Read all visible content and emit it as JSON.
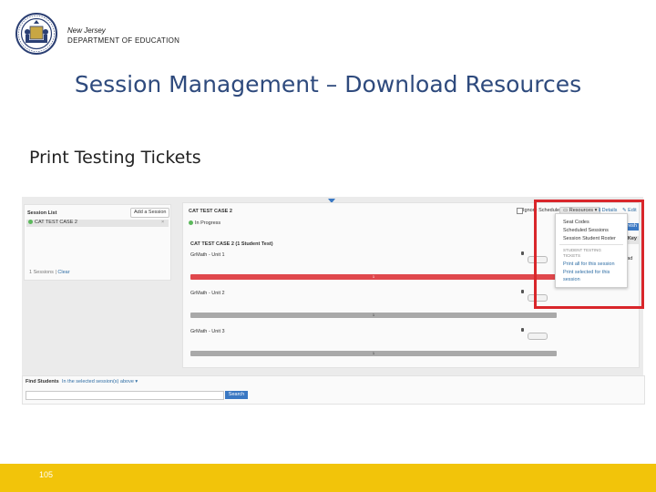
{
  "header": {
    "org_state": "New Jersey",
    "org_dept": "DEPARTMENT OF EDUCATION",
    "seal_icon": "nj-state-seal"
  },
  "slide": {
    "title": "Session Management – Download Resources",
    "subtitle": "Print Testing Tickets",
    "page_number": "105"
  },
  "app": {
    "session_list": {
      "title": "Session List",
      "add_button": "Add a Session",
      "item": "CAT TEST CASE 2",
      "close": "×",
      "footer_count": "1 Sessions",
      "footer_sep": "|",
      "footer_clear": "Clear"
    },
    "session": {
      "title": "CAT TEST CASE 2",
      "ignore_schedule": "Ignore Schedule",
      "resources_button": "Resources",
      "details": "Details",
      "edit": "Edit",
      "status": "In Progress",
      "refresh": "Refresh",
      "key": "Key",
      "upload": "pload",
      "student_test": "CAT TEST CASE 2 (1 Student Test)",
      "units": [
        {
          "name": "GrMath - Unit 1",
          "bar_label": "1"
        },
        {
          "name": "GrMath - Unit 2",
          "bar_label": "1"
        },
        {
          "name": "GrMath - Unit 3",
          "bar_label": "1"
        }
      ]
    },
    "resources_menu": {
      "items": [
        "Seat Codes",
        "Scheduled Sessions",
        "Session Student Roster"
      ],
      "section_label_1": "STUDENT TESTING",
      "section_label_2": "TICKETS",
      "print_all": "Print all for this session",
      "print_selected_1": "Print selected for this",
      "print_selected_2": "session"
    },
    "find_students": {
      "label": "Find Students",
      "scope": "In the selected session(s) above",
      "caret": "▾",
      "search_button": "Search",
      "search_value": ""
    }
  },
  "colors": {
    "title_blue": "#2e4a7d",
    "footer_yellow": "#f2c40a",
    "highlight_red": "#d9262b",
    "unit1_bar": "#e0474c",
    "neutral_bar": "#a9a9a9",
    "primary_blue": "#3a78c3"
  }
}
